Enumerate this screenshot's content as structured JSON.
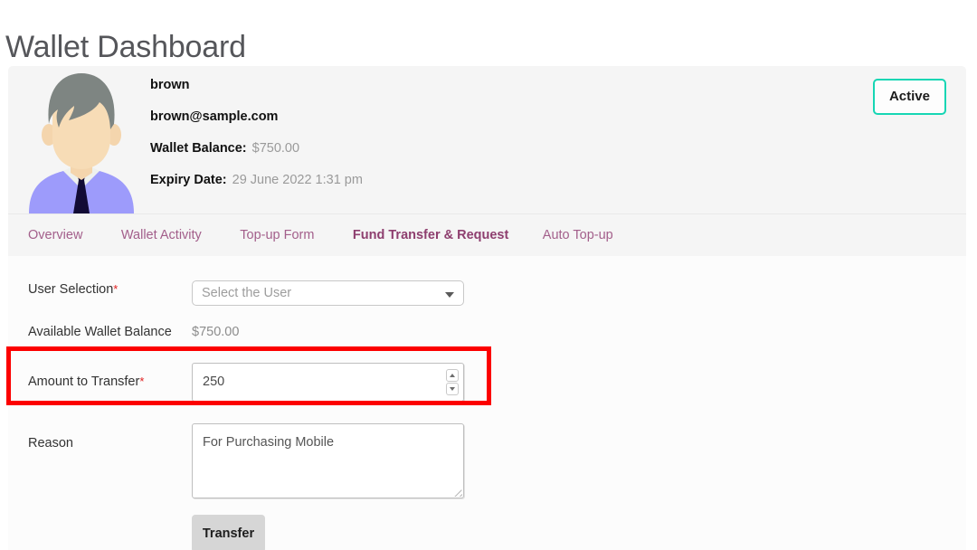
{
  "page": {
    "title": "Wallet Dashboard"
  },
  "profile": {
    "avatar_icon": "user-avatar-illustration",
    "username": "brown",
    "email": "brown@sample.com",
    "balance_label": "Wallet Balance:",
    "balance_value": "$750.00",
    "expiry_label": "Expiry Date:",
    "expiry_value": "29 June 2022 1:31 pm",
    "status_badge": "Active",
    "status_color": "#16d6b4"
  },
  "tabs": [
    {
      "label": "Overview",
      "active": false
    },
    {
      "label": "Wallet Activity",
      "active": false
    },
    {
      "label": "Top-up Form",
      "active": false
    },
    {
      "label": "Fund Transfer & Request",
      "active": true
    },
    {
      "label": "Auto Top-up",
      "active": false
    }
  ],
  "form": {
    "user_selection": {
      "label": "User Selection",
      "required_marker": "*",
      "placeholder": "Select the User",
      "value": "",
      "caret_icon": "chevron-down-icon"
    },
    "available_balance": {
      "label": "Available Wallet Balance",
      "value": "$750.00"
    },
    "amount": {
      "label": "Amount to Transfer",
      "required_marker": "*",
      "value": "250",
      "spinner_up_icon": "chevron-up-icon",
      "spinner_down_icon": "chevron-down-icon"
    },
    "reason": {
      "label": "Reason",
      "value": "For Purchasing Mobile"
    },
    "submit_label": "Transfer"
  },
  "annotation": {
    "highlight_color": "#fc0000",
    "highlight_target": "Amount to Transfer"
  }
}
